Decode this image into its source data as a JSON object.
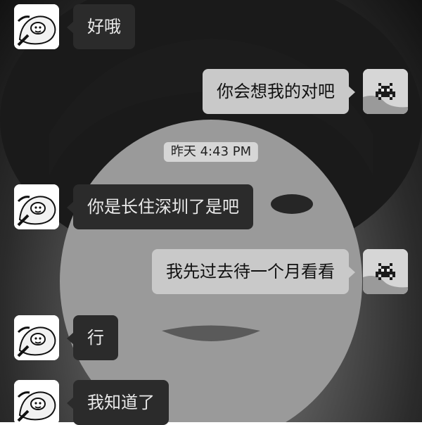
{
  "chat": {
    "timestamp": "昨天 4:43 PM",
    "messages": [
      {
        "side": "left",
        "text": "好哦",
        "avatar_icon": "cartoon-character-avatar-icon"
      },
      {
        "side": "right",
        "text": "你会想我的对吧",
        "avatar_icon": "space-invader-avatar-icon"
      },
      {
        "side": "left",
        "text": "你是长住深圳了是吧",
        "avatar_icon": "cartoon-character-avatar-icon"
      },
      {
        "side": "right",
        "text": "我先过去待一个月看看",
        "avatar_icon": "space-invader-avatar-icon"
      },
      {
        "side": "left",
        "text": "行",
        "avatar_icon": "cartoon-character-avatar-icon"
      },
      {
        "side": "left",
        "text": "我知道了",
        "avatar_icon": "cartoon-character-avatar-icon"
      }
    ]
  },
  "colors": {
    "incoming_bubble": "#2b2b2b",
    "outgoing_bubble": "#c9c9c9",
    "timestamp_pill": "#d6d6d6"
  }
}
